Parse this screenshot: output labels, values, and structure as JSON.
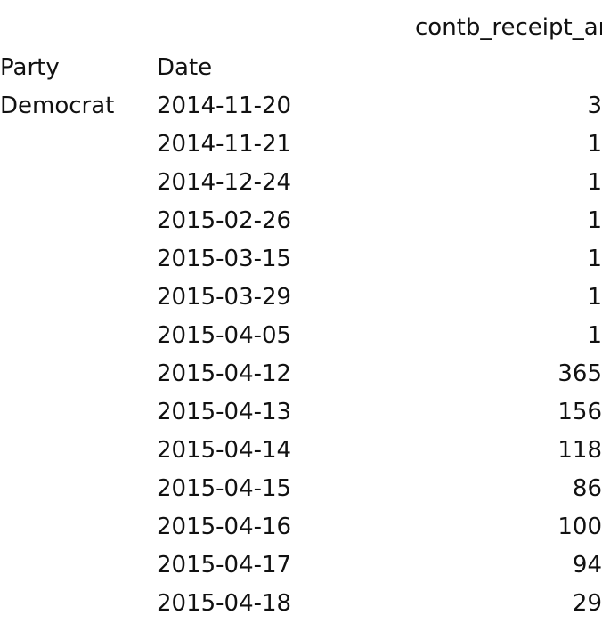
{
  "output": {
    "type": "dataframe-text-output",
    "value_column_header": "contb_receipt_amt",
    "index_names": {
      "level_0": "Party",
      "level_1": "Date"
    },
    "party_label": "Democrat",
    "rows": [
      {
        "party": "Democrat",
        "date": "2014-11-20",
        "contb_receipt_amt": "3"
      },
      {
        "party": "",
        "date": "2014-11-21",
        "contb_receipt_amt": "1"
      },
      {
        "party": "",
        "date": "2014-12-24",
        "contb_receipt_amt": "1"
      },
      {
        "party": "",
        "date": "2015-02-26",
        "contb_receipt_amt": "1"
      },
      {
        "party": "",
        "date": "2015-03-15",
        "contb_receipt_amt": "1"
      },
      {
        "party": "",
        "date": "2015-03-29",
        "contb_receipt_amt": "1"
      },
      {
        "party": "",
        "date": "2015-04-05",
        "contb_receipt_amt": "1"
      },
      {
        "party": "",
        "date": "2015-04-12",
        "contb_receipt_amt": "365"
      },
      {
        "party": "",
        "date": "2015-04-13",
        "contb_receipt_amt": "156"
      },
      {
        "party": "",
        "date": "2015-04-14",
        "contb_receipt_amt": "118"
      },
      {
        "party": "",
        "date": "2015-04-15",
        "contb_receipt_amt": "86"
      },
      {
        "party": "",
        "date": "2015-04-16",
        "contb_receipt_amt": "100"
      },
      {
        "party": "",
        "date": "2015-04-17",
        "contb_receipt_amt": "94"
      },
      {
        "party": "",
        "date": "2015-04-18",
        "contb_receipt_amt": "29"
      }
    ]
  },
  "colors": {
    "background": "#ffffff",
    "text": "#111111"
  }
}
